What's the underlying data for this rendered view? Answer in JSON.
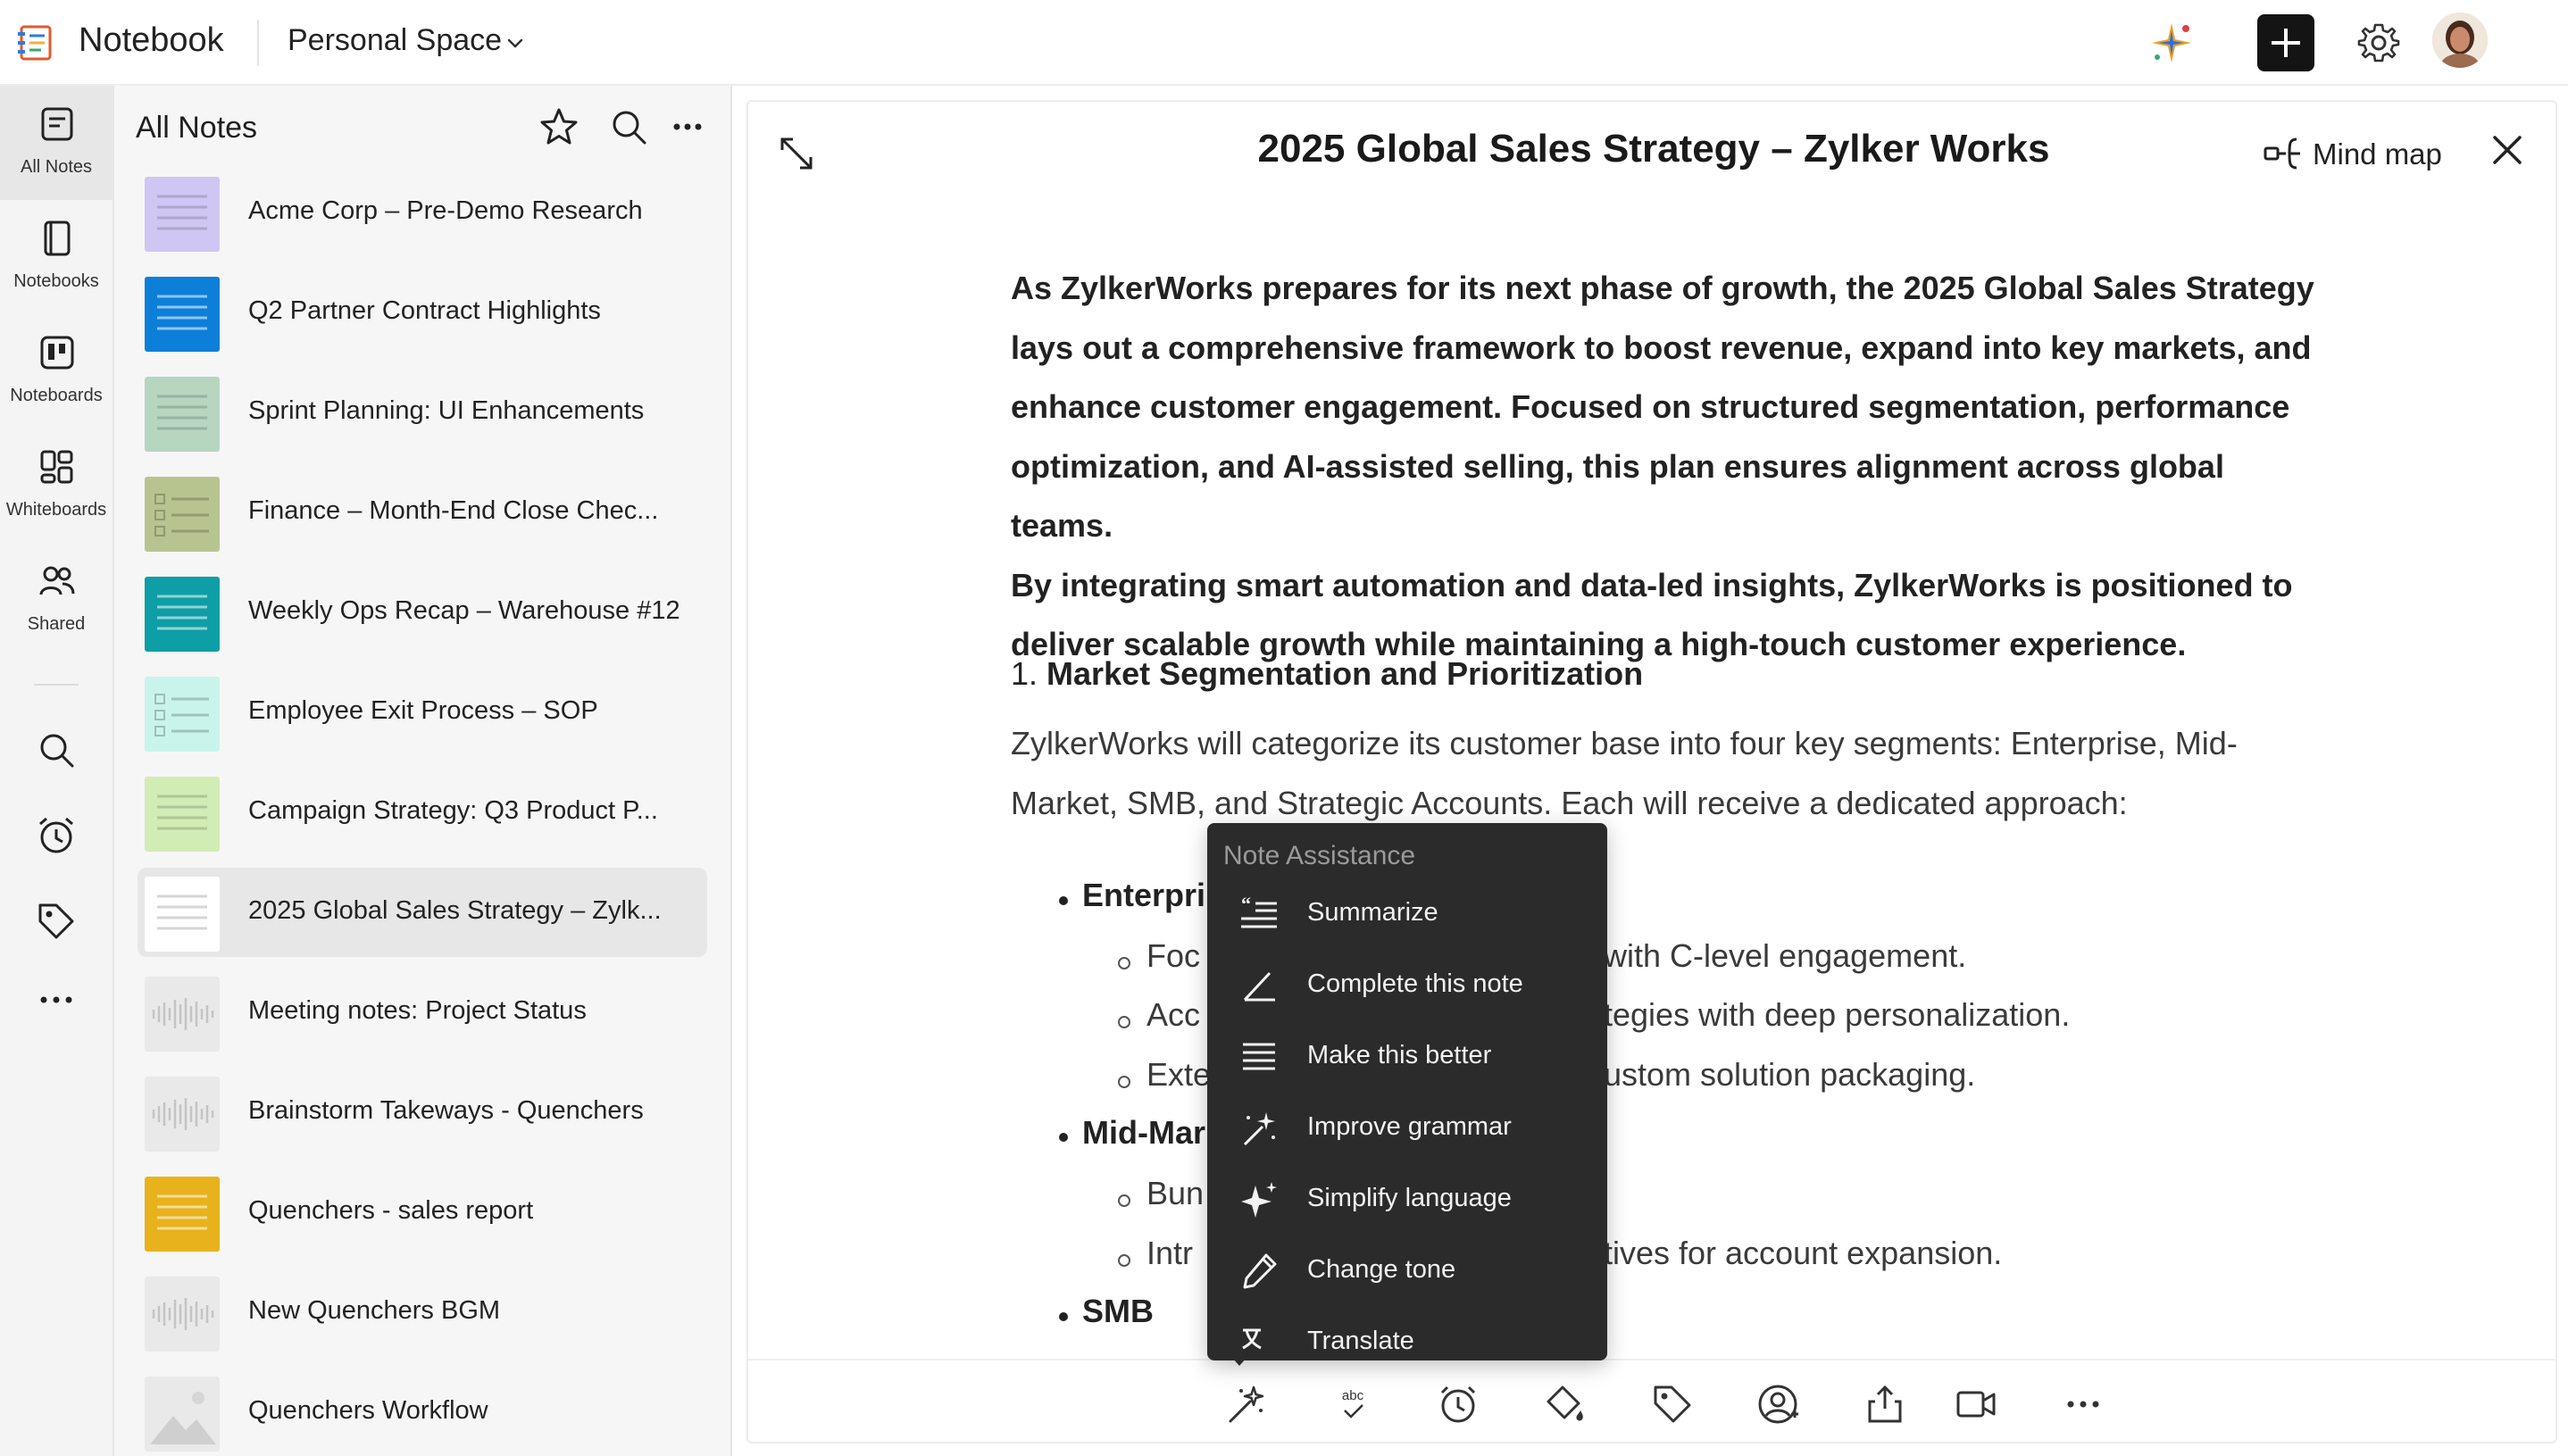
{
  "app": {
    "title": "Notebook",
    "space": "Personal Space"
  },
  "rail": {
    "items": [
      {
        "label": "All Notes",
        "icon": "all-notes-icon"
      },
      {
        "label": "Notebooks",
        "icon": "notebook-icon"
      },
      {
        "label": "Noteboards",
        "icon": "noteboard-icon"
      },
      {
        "label": "Whiteboards",
        "icon": "whiteboard-icon"
      },
      {
        "label": "Shared",
        "icon": "shared-users-icon"
      }
    ],
    "tools": [
      "search-icon",
      "alarm-clock-icon",
      "tag-icon",
      "more-dots-icon"
    ]
  },
  "notes": {
    "title": "All Notes",
    "items": [
      {
        "label": "Acme Corp – Pre-Demo Research",
        "thumb": "#cfc6f3",
        "style": "lines"
      },
      {
        "label": "Q2 Partner Contract Highlights",
        "thumb": "#0c7fd9",
        "style": "lines"
      },
      {
        "label": "Sprint Planning: UI Enhancements",
        "thumb": "#b6d6c0",
        "style": "lines"
      },
      {
        "label": "Finance – Month-End Close Chec...",
        "thumb": "#b8c48f",
        "style": "checklist"
      },
      {
        "label": "Weekly Ops Recap – Warehouse #12",
        "thumb": "#0e9ea5",
        "style": "lines"
      },
      {
        "label": "Employee Exit Process – SOP",
        "thumb": "#c9f4ec",
        "style": "checklist"
      },
      {
        "label": "Campaign Strategy: Q3 Product P...",
        "thumb": "#d2ecb6",
        "style": "lines"
      },
      {
        "label": "2025 Global Sales Strategy – Zylk...",
        "thumb": "#ffffff",
        "style": "lines",
        "selected": true
      },
      {
        "label": "Meeting notes: Project Status",
        "thumb": "#e9e9e9",
        "style": "audio"
      },
      {
        "label": "Brainstorm Takeways - Quenchers",
        "thumb": "#e9e9e9",
        "style": "audio"
      },
      {
        "label": "Quenchers - sales report",
        "thumb": "#e8b21c",
        "style": "lines"
      },
      {
        "label": "New Quenchers BGM",
        "thumb": "#e9e9e9",
        "style": "audio"
      },
      {
        "label": "Quenchers Workflow",
        "thumb": "#e9e9e9",
        "style": "image"
      }
    ]
  },
  "editor": {
    "title": "2025 Global Sales Strategy – Zylker Works",
    "mindmap_label": "Mind map",
    "intro_lines": [
      "As ZylkerWorks prepares for its next phase of growth, the 2025 Global Sales Strategy",
      "lays out a comprehensive framework to boost revenue, expand into key markets, and",
      "enhance customer engagement. Focused on structured segmentation, performance",
      "optimization, and AI-assisted selling, this plan ensures alignment across global teams.",
      "By integrating smart automation and data-led insights, ZylkerWorks is positioned to",
      "deliver scalable growth while maintaining a high-touch customer experience."
    ],
    "section_number": "1.",
    "section_title": "Market Segmentation and Prioritization",
    "section_lines": [
      "ZylkerWorks will categorize its customer base into four key segments: Enterprise, Mid-",
      "Market, SMB, and Strategic Accounts. Each will receive a dedicated approach:"
    ],
    "bullets": {
      "enterprise": "Enterpri",
      "enterprise_subs": [
        {
          "left": "Foc",
          "right": "with C-level engagement."
        },
        {
          "left": "Acc",
          "right": "tegies with deep personalization."
        },
        {
          "left": "Exte",
          "right": "ustom solution packaging."
        }
      ],
      "midmarket": "Mid-Mar",
      "midmarket_subs": [
        {
          "left": "Bun",
          "right": ""
        },
        {
          "left": "Intr",
          "right": "tives for account expansion."
        }
      ],
      "smb": "SMB"
    }
  },
  "assistant": {
    "title": "Note Assistance",
    "items": [
      {
        "label": "Summarize",
        "icon": "summarize-icon"
      },
      {
        "label": "Complete this note",
        "icon": "complete-note-icon"
      },
      {
        "label": "Make this better",
        "icon": "make-better-icon"
      },
      {
        "label": "Improve grammar",
        "icon": "magic-wand-icon"
      },
      {
        "label": "Simplify language",
        "icon": "sparkle-icon"
      },
      {
        "label": "Change tone",
        "icon": "pen-icon"
      },
      {
        "label": "Translate",
        "icon": "translate-icon"
      }
    ]
  },
  "toolbar": {
    "icons": [
      "ai-sparkle-icon",
      "spellcheck-icon",
      "reminder-icon",
      "color-fill-icon",
      "tag-icon",
      "share-user-icon",
      "export-icon",
      "video-icon",
      "more-dots-icon"
    ],
    "spellcheck_text": "abc"
  }
}
